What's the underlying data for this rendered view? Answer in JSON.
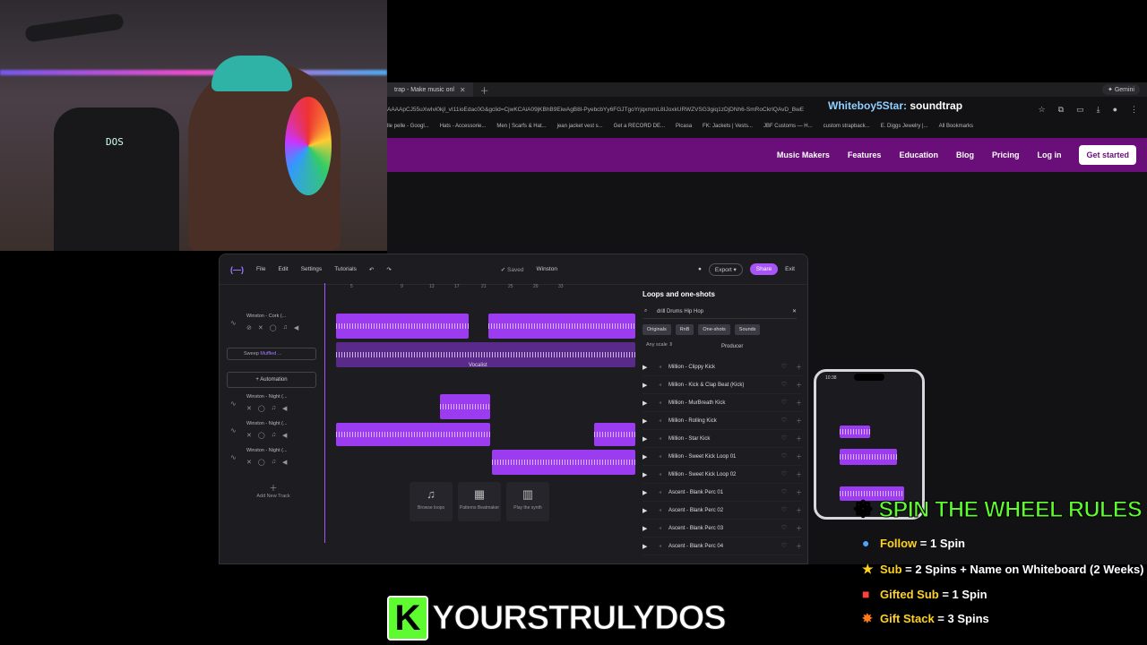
{
  "browser": {
    "tab_title": "trap - Make music onl",
    "gemini_label": "Gemini",
    "url": "AAAApCJ55uXwIvi0kjl_vI11ioEdac0G&gclid=CjwKCAiA09jKBhB9EiwAgB8l-PyebcbYy6FGJTgoYrjqxmmL8IJoxkURWZVSG3giq1zDjDNh6-SmRoCkrIQAvD_BwE",
    "overlay_user": "Whiteboy5Star:",
    "overlay_message": "soundtrap",
    "bookmarks": [
      "lle pelle - Googl...",
      "Hats - Accessorie...",
      "Men | Scarfs & Hat...",
      "jean jacket vest s...",
      "Get a RECORD DE...",
      "Picasa",
      "FK: Jackets | Vests...",
      "JBF Customs — H...",
      "custom strapback...",
      "E. Diggs Jewelry |...",
      "All Bookmarks"
    ]
  },
  "site_nav": {
    "items": [
      "Music Makers",
      "Features",
      "Education",
      "Blog",
      "Pricing",
      "Log in"
    ],
    "cta": "Get started"
  },
  "daw": {
    "menu": [
      "File",
      "Edit",
      "Settings",
      "Tutorials"
    ],
    "saved": "Saved",
    "project": "Winston",
    "export": "Export",
    "share": "Share",
    "exit": "Exit",
    "ruler": [
      "5",
      "9",
      "13",
      "17",
      "21",
      "25",
      "29",
      "33"
    ],
    "tracks": [
      "Winston - Cork (...",
      "Winston - Night (...",
      "Winston - Night (...",
      "Winston - Night (..."
    ],
    "sweep": {
      "label": "Sweep",
      "value": "Muffled ..."
    },
    "automation": "+ Automation",
    "add_track": "Add New Track",
    "vocalist": "Vocalist",
    "tiles": [
      {
        "label": "Browse loops"
      },
      {
        "label": "Patterns Beatmaker"
      },
      {
        "label": "Play the synth"
      }
    ]
  },
  "loops": {
    "title": "Loops and one-shots",
    "search": "drill Drums Hip Hop",
    "chips": [
      "Originals",
      "RnB",
      "One-shots",
      "Sounds"
    ],
    "scale": "Any scale",
    "producer": "Producer",
    "items": [
      "Million - Clippy Kick",
      "Million - Kick & Clap Beat (Kick)",
      "Million - MurBreath Kick",
      "Million - Rolling Kick",
      "Million - Star Kick",
      "Million - Sweet Kick Loop 01",
      "Million - Sweet Kick Loop 02",
      "Ascent - Blank Perc 01",
      "Ascent - Blank Perc 02",
      "Ascent - Blank Perc 03",
      "Ascent - Blank Perc 04"
    ]
  },
  "phone": {
    "time": "10:38"
  },
  "webcam": {
    "label": "DOS"
  },
  "rules": {
    "title_a": "SPIN THE WHEEL",
    "title_b": "RULES",
    "lines": [
      {
        "key": "Follow",
        "value": " = 1 Spin"
      },
      {
        "key": "Sub",
        "value": " = 2 Spins + Name on Whiteboard (2 Weeks)"
      },
      {
        "key": "Gifted Sub",
        "value": " = 1 Spin"
      },
      {
        "key": "Gift Stack",
        "value": " = 3 Spins"
      }
    ]
  },
  "brand": {
    "mark": "K",
    "name": "YOURSTRULYDOS"
  },
  "colors": {
    "accent": "#a855f7",
    "brand_green": "#5dfb2f",
    "site_purple": "#6a0f7a"
  }
}
